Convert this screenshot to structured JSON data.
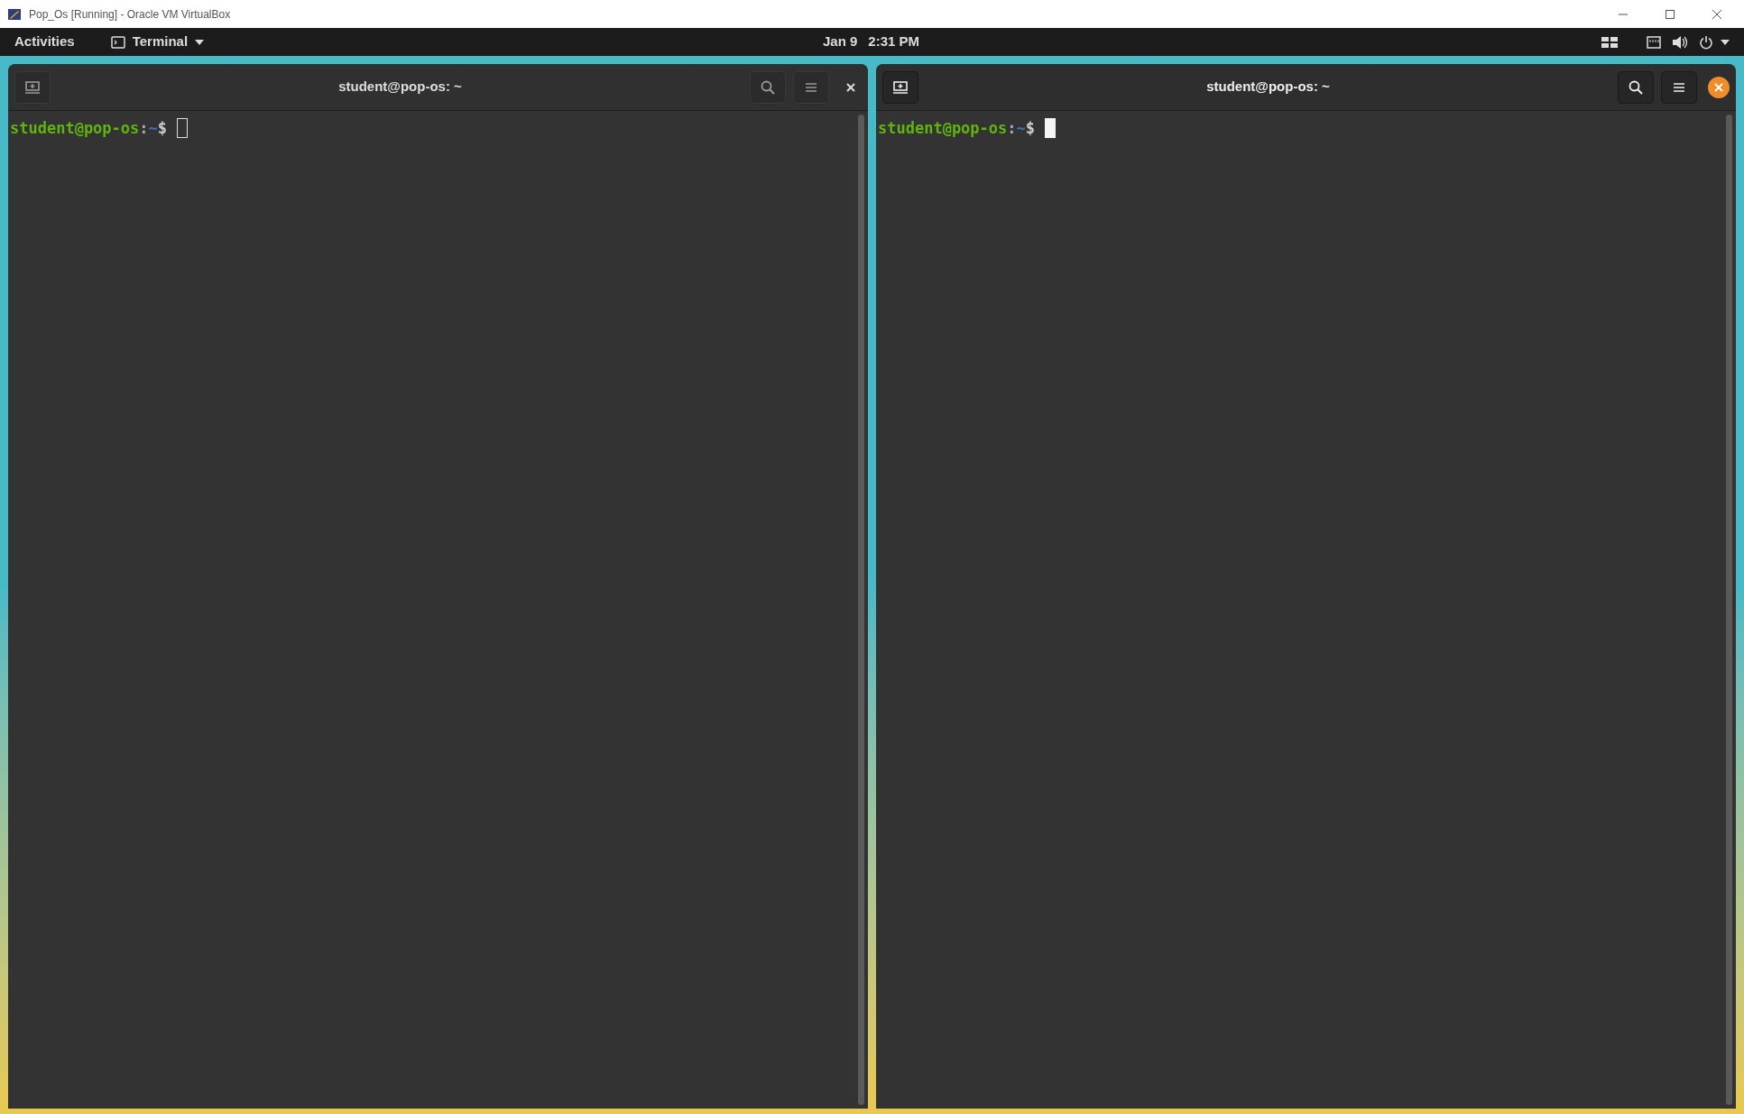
{
  "host_window": {
    "title": "Pop_Os [Running] - Oracle VM VirtualBox"
  },
  "top_bar": {
    "activities": "Activities",
    "app_menu": "Terminal",
    "date": "Jan 9",
    "time": "2:31 PM"
  },
  "terminals": [
    {
      "title": "student@pop-os: ~",
      "focused": false,
      "prompt": {
        "user_host": "student@pop-os",
        "separator": ":",
        "path": "~",
        "symbol": "$"
      }
    },
    {
      "title": "student@pop-os: ~",
      "focused": true,
      "prompt": {
        "user_host": "student@pop-os",
        "separator": ":",
        "path": "~",
        "symbol": "$"
      }
    }
  ]
}
